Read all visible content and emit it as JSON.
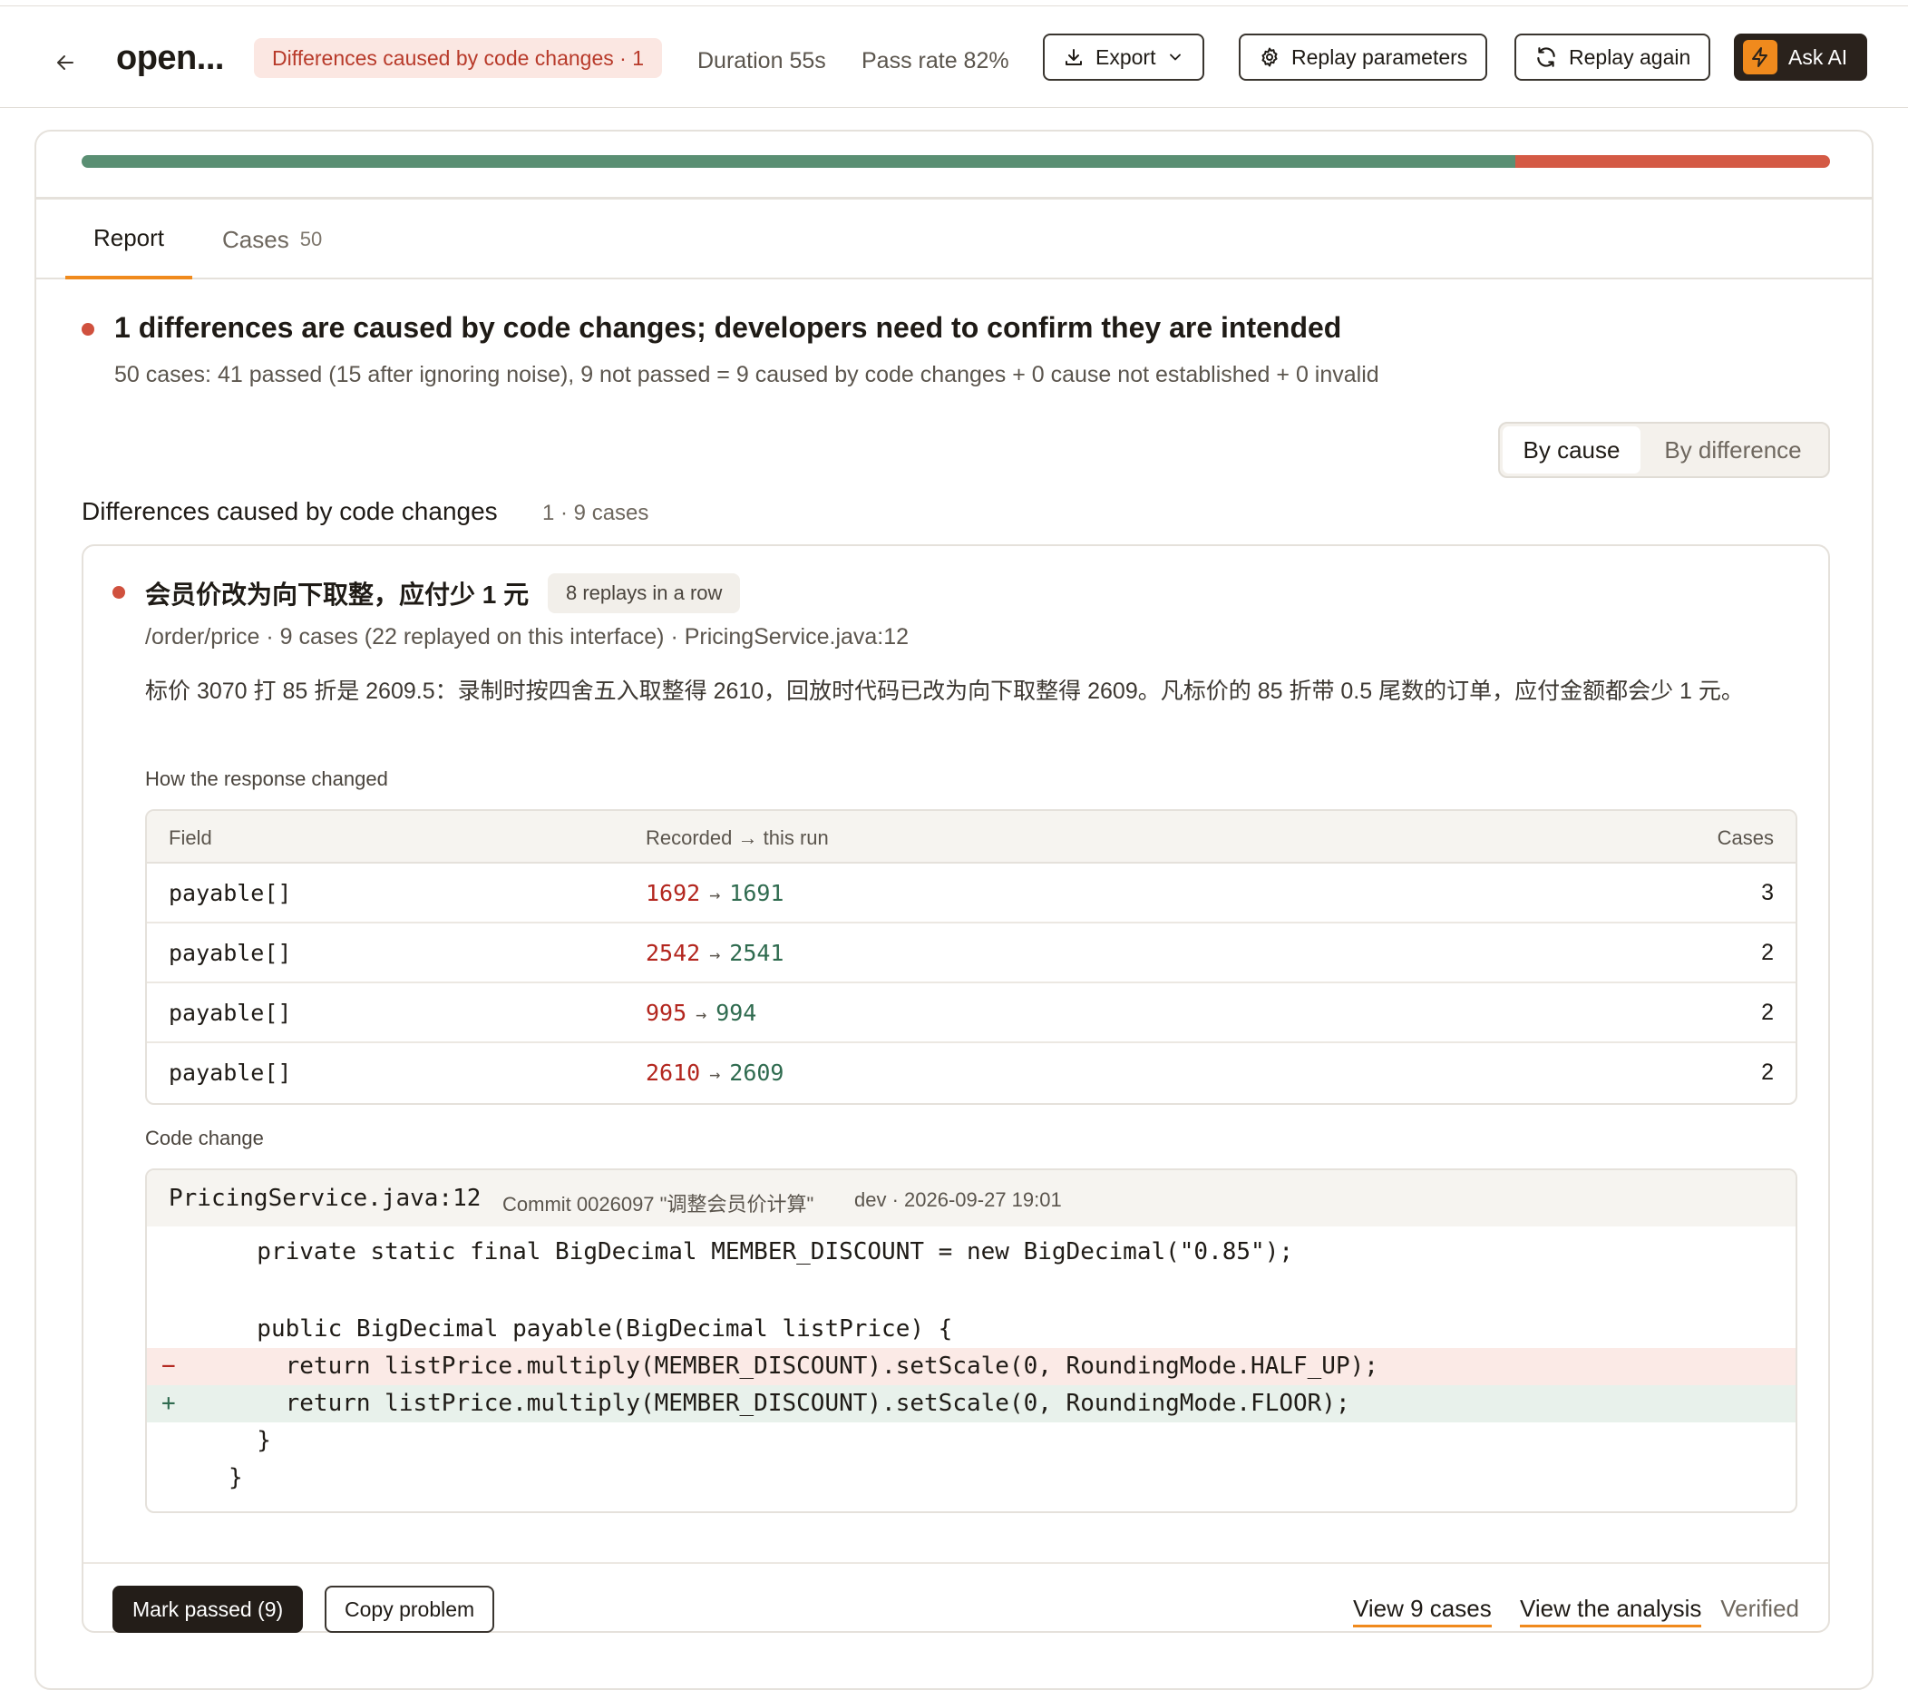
{
  "header": {
    "title": "open...",
    "badge": "Differences caused by code changes · 1",
    "duration": "Duration 55s",
    "pass_rate": "Pass rate 82%",
    "export_label": "Export",
    "replay_params_label": "Replay parameters",
    "replay_again_label": "Replay again",
    "ask_ai_label": "Ask AI"
  },
  "progress": {
    "passed_fraction": 0.82
  },
  "tabs": {
    "report": "Report",
    "cases": "Cases",
    "cases_count": "50"
  },
  "summary": {
    "title": "1 differences are caused by code changes; developers need to confirm they are intended",
    "subtitle": "50 cases: 41 passed (15 after ignoring noise), 9 not passed = 9 caused by code changes + 0 cause not established + 0 invalid"
  },
  "view_toggle": {
    "by_cause": "By cause",
    "by_difference": "By difference"
  },
  "section": {
    "title": "Differences caused by code changes",
    "count": "1 · 9 cases"
  },
  "cause": {
    "title": "会员价改为向下取整，应付少 1 元",
    "pill": "8 replays in a row",
    "meta": "/order/price · 9 cases (22 replayed on this interface) · PricingService.java:12",
    "description": "标价 3070 打 85 折是 2609.5：录制时按四舍五入取整得 2610，回放时代码已改为向下取整得 2609。凡标价的 85 折带 0.5 尾数的订单，应付金额都会少 1 元。",
    "response_label": "How the response changed",
    "table": {
      "headers": {
        "field": "Field",
        "change": "Recorded → this run",
        "cases": "Cases"
      },
      "rows": [
        {
          "field": "payable[]",
          "old": "1692",
          "new": "1691",
          "cases": "3"
        },
        {
          "field": "payable[]",
          "old": "2542",
          "new": "2541",
          "cases": "2"
        },
        {
          "field": "payable[]",
          "old": "995",
          "new": "994",
          "cases": "2"
        },
        {
          "field": "payable[]",
          "old": "2610",
          "new": "2609",
          "cases": "2"
        }
      ]
    },
    "code_label": "Code change",
    "code": {
      "file": "PricingService.java:12",
      "commit": "Commit 0026097 \"调整会员价计算\"",
      "meta": "dev · 2026-09-27 19:01",
      "lines": [
        {
          "type": "ctx",
          "marker": "",
          "text": "  private static final BigDecimal MEMBER_DISCOUNT = new BigDecimal(\"0.85\");"
        },
        {
          "type": "blank",
          "marker": "",
          "text": ""
        },
        {
          "type": "ctx",
          "marker": "",
          "text": "  public BigDecimal payable(BigDecimal listPrice) {"
        },
        {
          "type": "del",
          "marker": "−",
          "text": "    return listPrice.multiply(MEMBER_DISCOUNT).setScale(0, RoundingMode.HALF_UP);"
        },
        {
          "type": "add",
          "marker": "+",
          "text": "    return listPrice.multiply(MEMBER_DISCOUNT).setScale(0, RoundingMode.FLOOR);"
        },
        {
          "type": "ctx",
          "marker": "",
          "text": "  }"
        },
        {
          "type": "ctx",
          "marker": "",
          "text": "}"
        }
      ]
    },
    "actions": {
      "mark_passed": "Mark passed (9)",
      "copy_problem": "Copy problem",
      "view_cases": "View 9 cases",
      "view_analysis": "View the analysis",
      "verified": "Verified"
    }
  },
  "colors": {
    "pass": "#5a8f73",
    "fail": "#d45a45",
    "accent": "#f08a1d",
    "badge_bg": "#fbe7e2",
    "badge_text": "#b83a2a"
  }
}
